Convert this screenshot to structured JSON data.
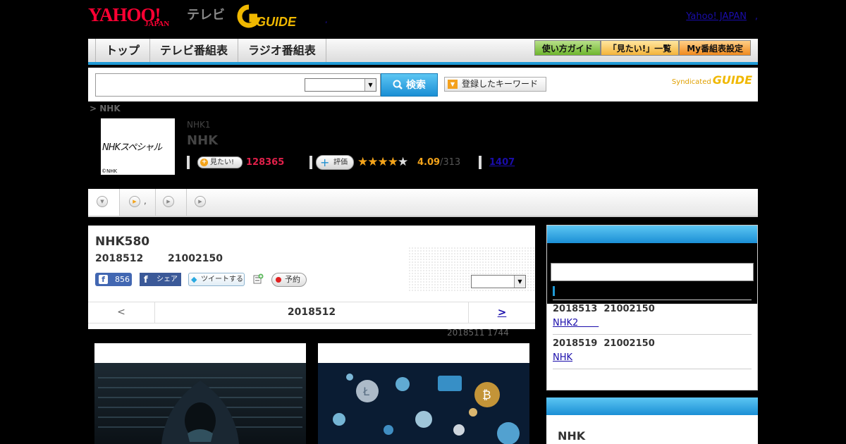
{
  "header": {
    "yahoo_logo_main": "YAHOO!",
    "yahoo_logo_sub": "JAPAN",
    "tv_label": "テレビ",
    "guide_logo": "G GUIDE",
    "yahoo_japan_link": "Yahoo! JAPAN",
    "link_separator": ",",
    "dot_mark": ","
  },
  "nav": {
    "tabs": [
      "トップ",
      "テレビ番組表",
      "ラジオ番組表"
    ],
    "buttons": [
      "使い方ガイド",
      "「見たい!」一覧",
      "My番組表設定"
    ]
  },
  "search": {
    "input_value": "",
    "select_value": "",
    "button_label": "検索",
    "keyword_button": "登録したキーワード",
    "syndicated_label": "Syndicated",
    "syndicated_logo": "GUIDE"
  },
  "breadcrumb": "> NHK",
  "program": {
    "logo_text": "NHKスペシャル",
    "logo_copyright": "©NHK",
    "channel": "NHK1",
    "title": "NHK",
    "mitai_button": "見たい!",
    "mitai_count": "128365",
    "hyoka_button": "評価",
    "stars_filled": 4,
    "rating": "4.09",
    "rating_count": "/313",
    "review_count": "1407"
  },
  "subtabs": [
    {
      "label": "",
      "icon": "chevron-down-icon"
    },
    {
      "label": ",",
      "icon": "play-icon"
    },
    {
      "label": "",
      "icon": "play-icon"
    },
    {
      "label": "",
      "icon": "play-icon"
    }
  ],
  "main": {
    "title": "NHK580",
    "date": "2018512",
    "time": "21002150",
    "fb_like_count": "856",
    "fb_share": "シェア",
    "tweet": "ツイートする",
    "reserve": "予約",
    "select_value": "",
    "pager_prev": "<",
    "pager_date": "2018512",
    "pager_next": ">",
    "updated": "2018511  1744"
  },
  "sidebar": {
    "items": [
      {
        "datetime": "2018513  21002150",
        "channel": "NHK2       "
      },
      {
        "datetime": "2018519  21002150",
        "channel": "NHK"
      }
    ],
    "box2_title": "NHK"
  },
  "colors": {
    "accent_blue": "#1f9ad6",
    "mitai_red": "#e0204a",
    "star_orange": "#f3a31a",
    "link_blue": "#1a0dab"
  }
}
